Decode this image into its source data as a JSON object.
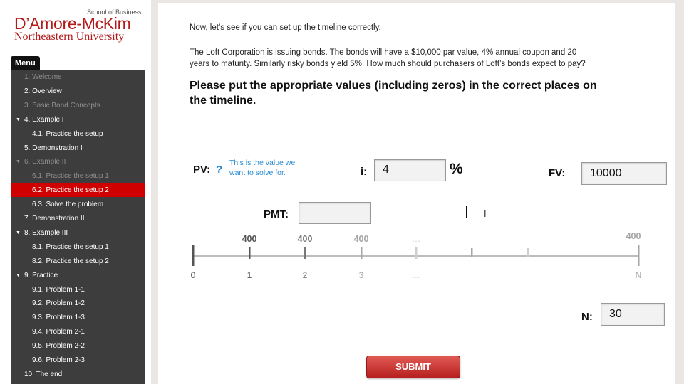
{
  "logo": {
    "super": "School of Business",
    "main": "D’Amore-McKim",
    "sub": "Northeastern University"
  },
  "menu": {
    "tab_label": "Menu",
    "items": [
      {
        "label": "1. Welcome",
        "state": "dim"
      },
      {
        "label": "2. Overview",
        "state": "normal"
      },
      {
        "label": "3. Basic Bond Concepts",
        "state": "dim"
      },
      {
        "label": "4. Example I",
        "state": "normal",
        "expanded": true
      },
      {
        "label": "4.1. Practice the setup",
        "state": "normal"
      },
      {
        "label": "5. Demonstration I",
        "state": "normal"
      },
      {
        "label": "6. Example II",
        "state": "dim",
        "expanded": true
      },
      {
        "label": "6.1. Practice the setup 1",
        "state": "dim"
      },
      {
        "label": "6.2. Practice the setup 2",
        "state": "active"
      },
      {
        "label": "6.3. Solve the problem",
        "state": "normal"
      },
      {
        "label": "7. Demonstration II",
        "state": "normal"
      },
      {
        "label": "8. Example III",
        "state": "normal",
        "expanded": true
      },
      {
        "label": "8.1. Practice the setup 1",
        "state": "normal"
      },
      {
        "label": "8.2. Practice the setup 2",
        "state": "normal"
      },
      {
        "label": "9. Practice",
        "state": "normal",
        "expanded": true
      },
      {
        "label": "9.1. Problem 1-1",
        "state": "normal"
      },
      {
        "label": "9.2. Problem 1-2",
        "state": "normal"
      },
      {
        "label": "9.3. Problem 1-3",
        "state": "normal"
      },
      {
        "label": "9.4. Problem 2-1",
        "state": "normal"
      },
      {
        "label": "9.5. Problem 2-2",
        "state": "normal"
      },
      {
        "label": "9.6. Problem 2-3",
        "state": "normal"
      },
      {
        "label": "10. The end",
        "state": "normal"
      }
    ],
    "expand_icon": "triangle-down-icon",
    "expand_glyph": "▼"
  },
  "main": {
    "intro": "Now, let’s see if you can set up the timeline correctly.",
    "problem_line1": "The Loft Corporation is issuing bonds. The bonds will have a $10,000 par value, 4% annual coupon and 20",
    "problem_line2": "years to maturity. Similarly risky bonds yield 5%.  How much should purchasers of Loft’s bonds expect to pay?",
    "instruction_line1": "Please put the appropriate values (including zeros) in the correct places on",
    "instruction_line2": "the timeline."
  },
  "fields": {
    "pv_label": "PV:",
    "pv_help": "?",
    "pv_note_line1": "This is the value we",
    "pv_note_line2": "want to solve for.",
    "i_label": "i:",
    "i_value": "4",
    "i_unit": "%",
    "fv_label": "FV:",
    "fv_value": "10000",
    "pmt_label": "PMT:",
    "pmt_value": "",
    "n_label": "N:",
    "n_value": "30"
  },
  "timeline": {
    "ticks": [
      {
        "label": "0",
        "value": "",
        "shade": "dark",
        "major": true
      },
      {
        "label": "1",
        "value": "400",
        "shade": "dark",
        "major": true
      },
      {
        "label": "2",
        "value": "400",
        "shade": "mid",
        "major": true
      },
      {
        "label": "3",
        "value": "400",
        "shade": "light",
        "major": true
      },
      {
        "label": "…",
        "value": "…",
        "shade": "faint",
        "major": true
      },
      {
        "label": "",
        "value": "",
        "shade": "light",
        "major": false
      },
      {
        "label": "",
        "value": "",
        "shade": "faint",
        "major": false
      },
      {
        "label": "N",
        "value": "400",
        "shade": "light",
        "major": true
      }
    ],
    "colors": {
      "dark": "#555555",
      "mid": "#777777",
      "light": "#a6a6a6",
      "faint": "#cfcfcf",
      "axis": "#bdbdbd"
    }
  },
  "submit_label": "SUBMIT"
}
